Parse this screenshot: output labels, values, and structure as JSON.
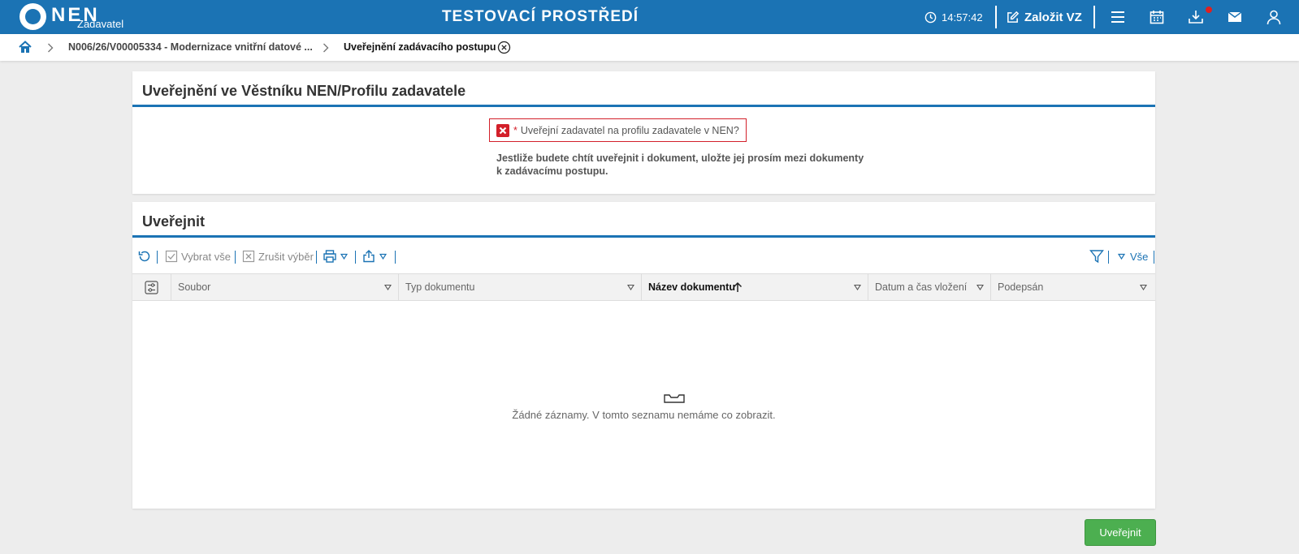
{
  "header": {
    "logo_text": "NEN",
    "logo_sub": "Zadavatel",
    "environment": "TESTOVACÍ PROSTŘEDÍ",
    "time": "14:57:42",
    "create_label": "Založit VZ"
  },
  "breadcrumb": {
    "item1": "N006/26/V00005334 - Modernizace vnitřní datové ...",
    "current": "Uveřejnění zadávacího postupu"
  },
  "panel1": {
    "title": "Uveřejnění ve Věstníku NEN/Profilu zadavatele",
    "required_mark": "*",
    "question": "Uveřejní zadavatel na profilu zadavatele v NEN?",
    "info_line1": "Jestliže budete chtít uveřejnit i dokument, uložte jej prosím mezi dokumenty",
    "info_line2": "k zadávacímu postupu."
  },
  "panel2": {
    "title": "Uveřejnit",
    "toolbar": {
      "select_all": "Vybrat vše",
      "cancel_selection": "Zrušit výběr",
      "filter_scope": "Vše"
    },
    "columns": [
      "Soubor",
      "Typ dokumentu",
      "Název dokumentu",
      "Datum a čas vložení",
      "Podepsán"
    ],
    "sorted_column": "Název dokumentu",
    "empty_text": "Žádné záznamy. V tomto seznamu nemáme co zobrazit."
  },
  "actions": {
    "publish": "Uveřejnit"
  },
  "colors": {
    "primary": "#1b73b4",
    "error": "#d3202a",
    "success": "#4caf50"
  }
}
